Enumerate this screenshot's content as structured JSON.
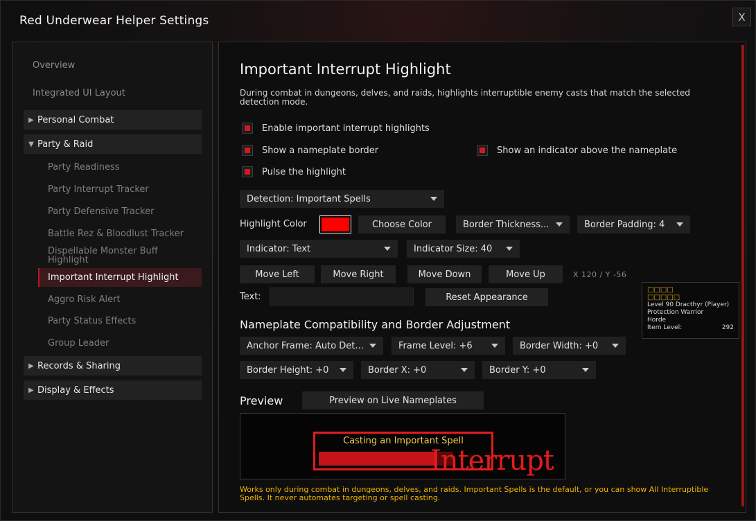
{
  "window": {
    "title": "Red Underwear Helper Settings",
    "close_label": "X"
  },
  "sidebar": {
    "top_items": [
      {
        "label": "Overview"
      },
      {
        "label": "Integrated UI Layout"
      }
    ],
    "categories": [
      {
        "label": "Personal Combat",
        "arrow": "▶",
        "expanded": false
      },
      {
        "label": "Party & Raid",
        "arrow": "▼",
        "expanded": true
      },
      {
        "label": "Records & Sharing",
        "arrow": "▶",
        "expanded": false
      },
      {
        "label": "Display & Effects",
        "arrow": "▶",
        "expanded": false
      }
    ],
    "party_raid_items": [
      {
        "label": "Party Readiness"
      },
      {
        "label": "Party Interrupt Tracker"
      },
      {
        "label": "Party Defensive Tracker"
      },
      {
        "label": "Battle Rez & Bloodlust Tracker"
      },
      {
        "label": "Dispellable Monster Buff Highlight"
      },
      {
        "label": "Important Interrupt Highlight",
        "active": true
      },
      {
        "label": "Aggro Risk Alert"
      },
      {
        "label": "Party Status Effects"
      },
      {
        "label": "Group Leader"
      }
    ]
  },
  "main": {
    "heading": "Important Interrupt Highlight",
    "description": "During combat in dungeons, delves, and raids, highlights interruptible enemy casts that match the selected detection mode.",
    "checkboxes": {
      "enable": {
        "label": "Enable important interrupt highlights",
        "checked": true
      },
      "nameplate_border": {
        "label": "Show a nameplate border",
        "checked": true
      },
      "indicator_above": {
        "label": "Show an indicator above the nameplate",
        "checked": true
      },
      "pulse": {
        "label": "Pulse the highlight",
        "checked": true
      }
    },
    "detection_dropdown": "Detection: Important Spells",
    "highlight_color_label": "Highlight Color",
    "highlight_color": "#ff0000",
    "choose_color_label": "Choose Color",
    "border_thickness_dropdown": "Border Thickness...",
    "border_padding_dropdown": "Border Padding: 4",
    "indicator_dropdown": "Indicator: Text",
    "indicator_size_dropdown": "Indicator Size: 40",
    "move_buttons": {
      "left": "Move Left",
      "right": "Move Right",
      "down": "Move Down",
      "up": "Move Up"
    },
    "coords": "X 120 / Y -56",
    "text_label": "Text:",
    "text_value": "",
    "reset_appearance_label": "Reset Appearance",
    "compat_heading": "Nameplate Compatibility and Border Adjustment",
    "compat_dropdowns": {
      "anchor_frame": "Anchor Frame: Auto Det...",
      "frame_level": "Frame Level: +6",
      "border_width": "Border Width: +0",
      "border_height": "Border Height: +0",
      "border_x": "Border X: +0",
      "border_y": "Border Y: +0"
    },
    "preview_heading": "Preview",
    "preview_live_label": "Preview on Live Nameplates",
    "preview": {
      "cast_text": "Casting an Important Spell",
      "indicator_text": "Interrupt"
    },
    "footnote": "Works only during combat in dungeons, delves, and raids. Important Spells is the default, or you can show All Interruptible Spells. It never automates targeting or spell casting."
  },
  "tooltip": {
    "name": "□□□□",
    "guild": "□□□□□",
    "level_line": "Level 90 Dracthyr (Player)",
    "spec_line": "Protection Warrior",
    "faction": "Horde",
    "item_level_label": "Item Level:",
    "item_level_value": "292"
  },
  "colors": {
    "accent_red": "#d11a1f",
    "warning_text": "#f2b400",
    "cast_text": "#f2c94c"
  }
}
